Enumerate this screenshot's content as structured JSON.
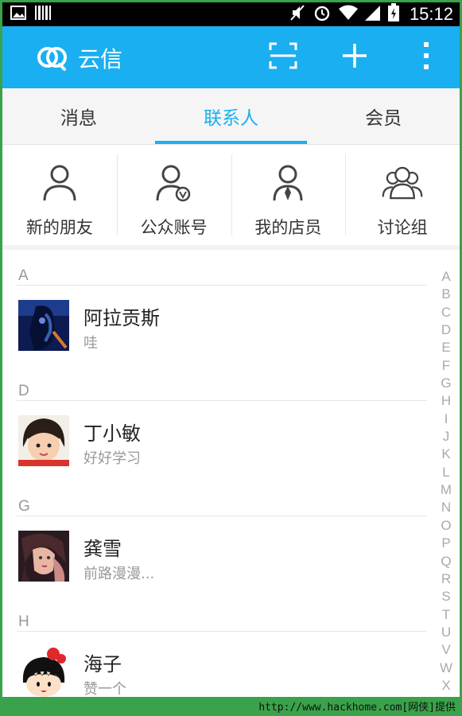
{
  "status_bar": {
    "time": "15:12"
  },
  "app_bar": {
    "title": "云信",
    "icons": [
      "yunxin-logo-icon",
      "scan-icon",
      "plus-icon",
      "more-vertical-icon"
    ],
    "color": "#1aaff0"
  },
  "tabs": [
    {
      "label": "消息",
      "active": false
    },
    {
      "label": "联系人",
      "active": true
    },
    {
      "label": "会员",
      "active": false
    }
  ],
  "quick_items": [
    {
      "label": "新的朋友",
      "icon": "person-icon"
    },
    {
      "label": "公众账号",
      "icon": "verified-person-icon"
    },
    {
      "label": "我的店员",
      "icon": "person-tie-icon"
    },
    {
      "label": "讨论组",
      "icon": "group-icon"
    }
  ],
  "contacts": [
    {
      "letter": "A",
      "name": "阿拉贡斯",
      "subtitle": "哇"
    },
    {
      "letter": "D",
      "name": "丁小敏",
      "subtitle": "好好学习"
    },
    {
      "letter": "G",
      "name": "龚雪",
      "subtitle": "前路漫漫..."
    },
    {
      "letter": "H",
      "name": "海子",
      "subtitle": "赞一个"
    }
  ],
  "index_letters": [
    "A",
    "B",
    "C",
    "D",
    "E",
    "F",
    "G",
    "H",
    "I",
    "J",
    "K",
    "L",
    "M",
    "N",
    "O",
    "P",
    "Q",
    "R",
    "S",
    "T",
    "U",
    "V",
    "W",
    "X"
  ],
  "watermark": "http://www.hackhome.com[网侠]提供",
  "colors": {
    "accent": "#1aaff0",
    "frame": "#3aa24a"
  }
}
